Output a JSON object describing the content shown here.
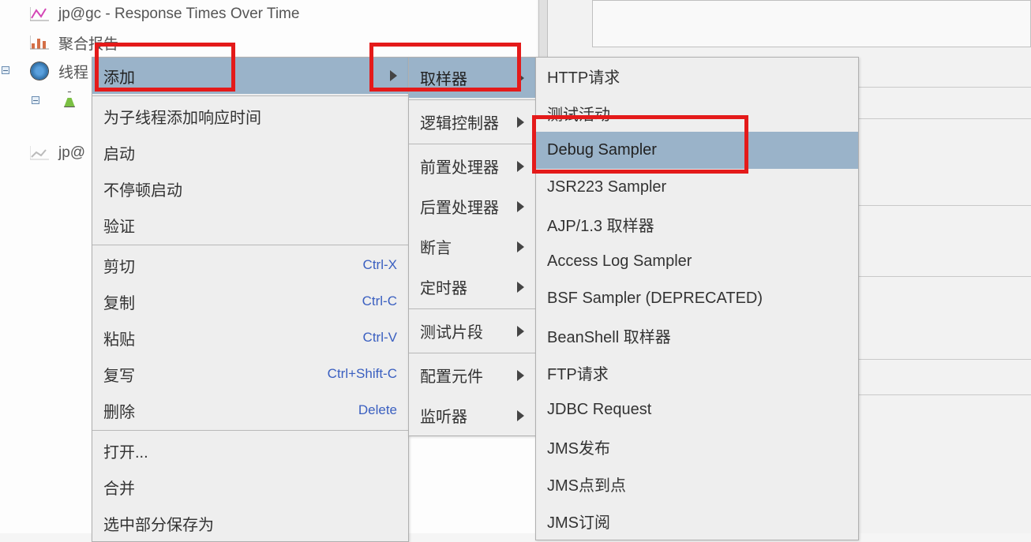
{
  "tree": {
    "item1": "jp@gc - Response Times Over Time",
    "item2": "聚合报告",
    "item3": "线程",
    "item4": "",
    "item5": "jp@"
  },
  "menu1": {
    "add": "添加",
    "addTimer": "为子线程添加响应时间",
    "start": "启动",
    "startNoPause": "不停顿启动",
    "validate": "验证",
    "cut": "剪切",
    "cutKey": "Ctrl-X",
    "copy": "复制",
    "copyKey": "Ctrl-C",
    "paste": "粘贴",
    "pasteKey": "Ctrl-V",
    "duplicate": "复写",
    "duplicateKey": "Ctrl+Shift-C",
    "delete": "删除",
    "deleteKey": "Delete",
    "open": "打开...",
    "merge": "合并",
    "saveAs": "选中部分保存为"
  },
  "menu2": {
    "sampler": "取样器",
    "logic": "逻辑控制器",
    "preproc": "前置处理器",
    "postproc": "后置处理器",
    "assertion": "断言",
    "timer": "定时器",
    "fragment": "测试片段",
    "config": "配置元件",
    "listener": "监听器"
  },
  "menu3": {
    "http": "HTTP请求",
    "testAction": "测试活动",
    "debug": "Debug Sampler",
    "jsr223": "JSR223 Sampler",
    "ajp": "AJP/1.3 取样器",
    "accessLog": "Access Log Sampler",
    "bsf": "BSF Sampler (DEPRECATED)",
    "beanshell": "BeanShell 取样器",
    "ftp": "FTP请求",
    "jdbc": "JDBC Request",
    "jmsPub": "JMS发布",
    "jmsP2P": "JMS点到点",
    "jmsSub": "JMS订阅"
  }
}
